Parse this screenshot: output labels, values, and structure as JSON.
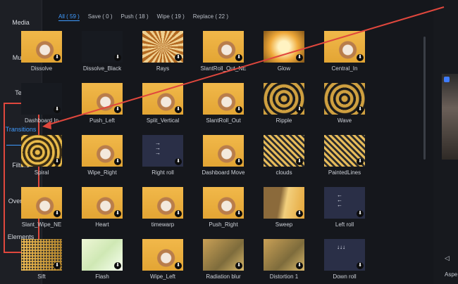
{
  "sidebar": {
    "items": [
      {
        "label": "Media"
      },
      {
        "label": "Music"
      },
      {
        "label": "Text"
      },
      {
        "label": "Transitions",
        "active": true
      },
      {
        "label": "Filters"
      },
      {
        "label": "Overlays"
      },
      {
        "label": "Elements"
      }
    ]
  },
  "tabs": [
    {
      "label": "All ( 59 )",
      "active": true
    },
    {
      "label": "Save ( 0 )"
    },
    {
      "label": "Push ( 18 )"
    },
    {
      "label": "Wipe ( 19 )"
    },
    {
      "label": "Replace ( 22 )"
    }
  ],
  "transitions": [
    [
      "Dissolve",
      "Dissolve_Black",
      "Rays",
      "SlantRoll_Out_NE",
      "Glow",
      "Central_In"
    ],
    [
      "Dashboard In",
      "Push_Left",
      "Split_Vertical",
      "SlantRoll_Out",
      "Ripple",
      "Wave"
    ],
    [
      "Spiral",
      "Wipe_Right",
      "Right roll",
      "Dashboard Move",
      "clouds",
      "PaintedLines"
    ],
    [
      "Slant_Wipe_NE",
      "Heart",
      "timewarp",
      "Push_Right",
      "Sweep",
      "Left roll"
    ],
    [
      "Sift",
      "Flash",
      "Wipe_Left",
      "Radiation blur",
      "Distortion 1",
      "Down roll"
    ]
  ],
  "preview": {
    "aspect_label": "Aspe",
    "play_icon": "◁"
  },
  "colors": {
    "accent": "#3f9bff",
    "highlight": "#e0473d"
  }
}
